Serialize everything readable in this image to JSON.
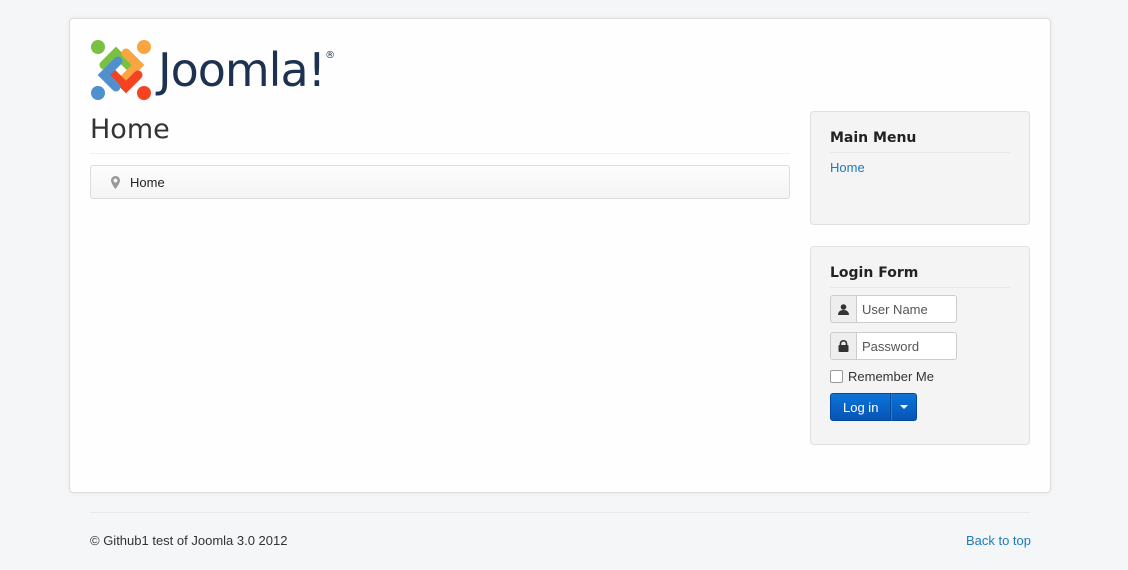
{
  "logo": {
    "text": "Joomla!",
    "registered": "®"
  },
  "main": {
    "page_title": "Home",
    "breadcrumb": {
      "current": "Home"
    }
  },
  "sidebar": {
    "main_menu": {
      "title": "Main Menu",
      "items": [
        {
          "label": "Home"
        }
      ]
    },
    "login_form": {
      "title": "Login Form",
      "username_placeholder": "User Name",
      "password_placeholder": "Password",
      "remember_label": "Remember Me",
      "login_label": "Log in"
    }
  },
  "footer": {
    "copyright": "© Github1 test of Joomla 3.0 2012",
    "back_to_top": "Back to top"
  },
  "colors": {
    "link": "#1b7cbc",
    "primary_button": "#0a64c8",
    "logo_text": "#1c3250"
  }
}
